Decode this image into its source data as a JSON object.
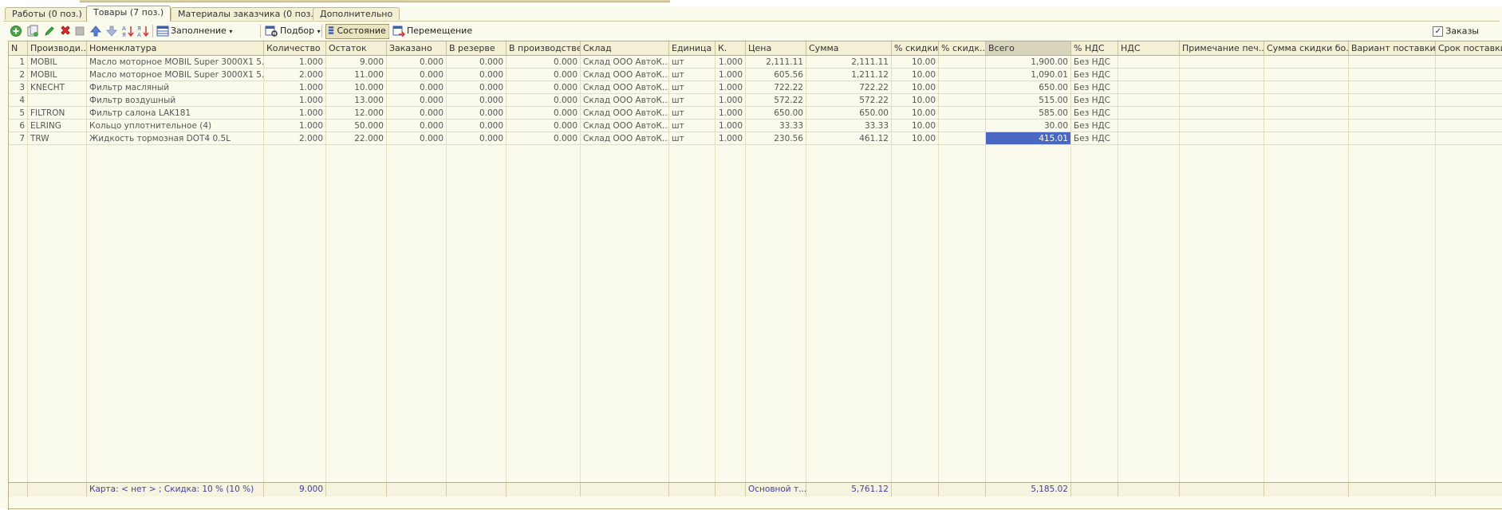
{
  "tabs": [
    {
      "label": "Работы (0 поз.)",
      "active": false
    },
    {
      "label": "Товары (7 поз.)",
      "active": true
    },
    {
      "label": "Материалы заказчика (0 поз.)",
      "active": false
    },
    {
      "label": "Дополнительно",
      "active": false
    }
  ],
  "toolbar": {
    "fill_label": "Заполнение",
    "pick_label": "Подбор",
    "status_label": "Состояние",
    "move_label": "Перемещение",
    "orders_label": "Заказы",
    "orders_checked": true
  },
  "columns": [
    "N",
    "Производи...",
    "Номенклатура",
    "Количество",
    "Остаток",
    "Заказано",
    "В резерве",
    "В производстве",
    "Склад",
    "Единица",
    "К.",
    "Цена",
    "Сумма",
    "% скидки",
    "% скидк...",
    "Всего",
    "% НДС",
    "НДС",
    "Примечание печ...",
    "Сумма скидки бо...",
    "Вариант поставки",
    "Срок поставки"
  ],
  "rows": [
    [
      "1",
      "MOBIL",
      "Масло моторное MOBIL Super 3000X1 5...",
      "1.000",
      "9.000",
      "0.000",
      "0.000",
      "0.000",
      "Склад ООО АвтоК...",
      "шт",
      "1.000",
      "2,111.11",
      "2,111.11",
      "10.00",
      "",
      "1,900.00",
      "Без НДС",
      "",
      "",
      "",
      "",
      ""
    ],
    [
      "2",
      "MOBIL",
      "Масло моторное MOBIL Super 3000X1 5...",
      "2.000",
      "11.000",
      "0.000",
      "0.000",
      "0.000",
      "Склад ООО АвтоК...",
      "шт",
      "1.000",
      "605.56",
      "1,211.12",
      "10.00",
      "",
      "1,090.01",
      "Без НДС",
      "",
      "",
      "",
      "",
      ""
    ],
    [
      "3",
      "KNECHT",
      "Фильтр масляный",
      "1.000",
      "10.000",
      "0.000",
      "0.000",
      "0.000",
      "Склад ООО АвтоК...",
      "шт",
      "1.000",
      "722.22",
      "722.22",
      "10.00",
      "",
      "650.00",
      "Без НДС",
      "",
      "",
      "",
      "",
      ""
    ],
    [
      "4",
      "",
      "Фильтр воздушный",
      "1.000",
      "13.000",
      "0.000",
      "0.000",
      "0.000",
      "Склад ООО АвтоК...",
      "шт",
      "1.000",
      "572.22",
      "572.22",
      "10.00",
      "",
      "515.00",
      "Без НДС",
      "",
      "",
      "",
      "",
      ""
    ],
    [
      "5",
      "FILTRON",
      "Фильтр салона LAK181",
      "1.000",
      "12.000",
      "0.000",
      "0.000",
      "0.000",
      "Склад ООО АвтоК...",
      "шт",
      "1.000",
      "650.00",
      "650.00",
      "10.00",
      "",
      "585.00",
      "Без НДС",
      "",
      "",
      "",
      "",
      ""
    ],
    [
      "6",
      "ELRING",
      "Кольцо уплотнительное (4)",
      "1.000",
      "50.000",
      "0.000",
      "0.000",
      "0.000",
      "Склад ООО АвтоК...",
      "шт",
      "1.000",
      "33.33",
      "33.33",
      "10.00",
      "",
      "30.00",
      "Без НДС",
      "",
      "",
      "",
      "",
      ""
    ],
    [
      "7",
      "TRW",
      "Жидкость тормозная  DOT4  0.5L",
      "2.000",
      "22.000",
      "0.000",
      "0.000",
      "0.000",
      "Склад ООО АвтоК...",
      "шт",
      "1.000",
      "230.56",
      "461.12",
      "10.00",
      "",
      "415.01",
      "Без НДС",
      "",
      "",
      "",
      "",
      ""
    ]
  ],
  "footer": {
    "card": "Карта: < нет > ; Скидка: 10 % (10 %)",
    "qty_total": "9.000",
    "price_type": "Основной т...",
    "sum_total": "5,761.12",
    "grand_total": "5,185.02"
  },
  "colors": {
    "selection": "#4b67c4",
    "background": "#fbfbed",
    "footer_text": "#4040a0"
  }
}
